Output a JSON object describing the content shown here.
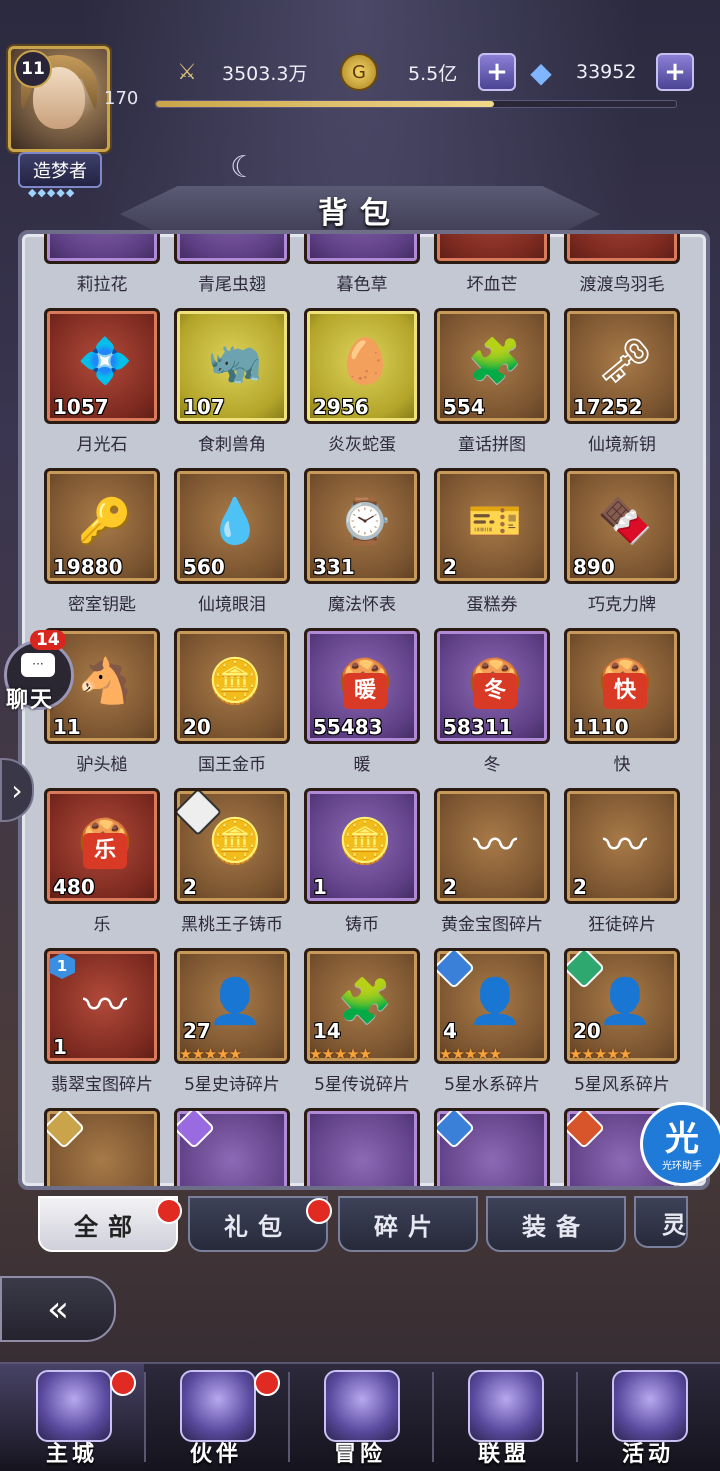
{
  "header": {
    "player_level": "11",
    "rank_title": "造梦者",
    "rank_stars": "◆◆◆◆◆",
    "exp_value": "170",
    "exp_progress": 0.65,
    "power": "3503.3万",
    "gold": "5.5亿",
    "diamonds": "33952",
    "plus": "+"
  },
  "page_title": "背包",
  "colors": {
    "accent": "#8b7fd6",
    "reddot": "#e02a22",
    "panel": "#c4c8d3"
  },
  "items": [
    {
      "name": "莉拉花",
      "qty": "",
      "q": "purple",
      "icon": "🌸"
    },
    {
      "name": "青尾虫翅",
      "qty": "",
      "q": "purple",
      "icon": "🦋"
    },
    {
      "name": "暮色草",
      "qty": "",
      "q": "purple",
      "icon": "🌿"
    },
    {
      "name": "坏血芒",
      "qty": "",
      "q": "red",
      "icon": "🍂"
    },
    {
      "name": "渡渡鸟羽毛",
      "qty": "",
      "q": "red",
      "icon": "🪶"
    },
    {
      "name": "月光石",
      "qty": "1057",
      "q": "red",
      "icon": "💠"
    },
    {
      "name": "食刺兽角",
      "qty": "107",
      "q": "gold",
      "icon": "🦏"
    },
    {
      "name": "炎灰蛇蛋",
      "qty": "2956",
      "q": "gold",
      "icon": "🥚"
    },
    {
      "name": "童话拼图",
      "qty": "554",
      "q": "bronze",
      "icon": "🧩"
    },
    {
      "name": "仙境新钥",
      "qty": "17252",
      "q": "bronze",
      "icon": "🗝"
    },
    {
      "name": "密室钥匙",
      "qty": "19880",
      "q": "bronze",
      "icon": "🔑"
    },
    {
      "name": "仙境眼泪",
      "qty": "560",
      "q": "bronze",
      "icon": "💧"
    },
    {
      "name": "魔法怀表",
      "qty": "331",
      "q": "bronze",
      "icon": "⌚"
    },
    {
      "name": "蛋糕券",
      "qty": "2",
      "q": "bronze",
      "icon": "🎫"
    },
    {
      "name": "巧克力牌",
      "qty": "890",
      "q": "bronze",
      "icon": "🍫"
    },
    {
      "name": "驴头槌",
      "qty": "11",
      "q": "bronze",
      "icon": "🐴"
    },
    {
      "name": "国王金币",
      "qty": "20",
      "q": "bronze",
      "icon": "🪙"
    },
    {
      "name": "暖",
      "qty": "55483",
      "q": "purple",
      "icon": "🍪",
      "glyph": "暖"
    },
    {
      "name": "冬",
      "qty": "58311",
      "q": "purple",
      "icon": "🍪",
      "glyph": "冬"
    },
    {
      "name": "快",
      "qty": "1110",
      "q": "bronze",
      "icon": "🍪",
      "glyph": "快"
    },
    {
      "name": "乐",
      "qty": "480",
      "q": "red",
      "icon": "🍪",
      "glyph": "乐"
    },
    {
      "name": "黑桃王子铸币",
      "qty": "2",
      "q": "bronze",
      "icon": "🪙",
      "badge": "portrait"
    },
    {
      "name": "铸币",
      "qty": "1",
      "q": "purple",
      "icon": "🪙"
    },
    {
      "name": "黄金宝图碎片",
      "qty": "2",
      "q": "bronze",
      "icon": "〰"
    },
    {
      "name": "狂徒碎片",
      "qty": "2",
      "q": "bronze",
      "icon": "〰"
    },
    {
      "name": "翡翠宝图碎片",
      "qty": "1",
      "q": "red",
      "icon": "〰",
      "badge": "hex",
      "badge_text": "1"
    },
    {
      "name": "5星史诗碎片",
      "qty": "27",
      "q": "bronze",
      "icon": "👤",
      "stars": "★★★★★"
    },
    {
      "name": "5星传说碎片",
      "qty": "14",
      "q": "bronze",
      "icon": "🧩",
      "stars": "★★★★★"
    },
    {
      "name": "5星水系碎片",
      "qty": "4",
      "q": "bronze",
      "icon": "👤",
      "stars": "★★★★★",
      "badge": "element",
      "badge_color": "#3a7fd8"
    },
    {
      "name": "5星风系碎片",
      "qty": "20",
      "q": "bronze",
      "icon": "👤",
      "stars": "★★★★★",
      "badge": "element",
      "badge_color": "#2fa870"
    },
    {
      "name": "",
      "qty": "",
      "q": "bronze",
      "icon": "",
      "badge": "element",
      "badge_color": "#c9a44a"
    },
    {
      "name": "",
      "qty": "",
      "q": "purple",
      "icon": "",
      "badge": "element",
      "badge_color": "#9a6ae0"
    },
    {
      "name": "",
      "qty": "",
      "q": "purple",
      "icon": ""
    },
    {
      "name": "",
      "qty": "",
      "q": "purple",
      "icon": "",
      "badge": "element",
      "badge_color": "#3a7fd8"
    },
    {
      "name": "",
      "qty": "",
      "q": "purple",
      "icon": "",
      "badge": "element",
      "badge_color": "#d8542a"
    }
  ],
  "tabs": [
    {
      "label": "全部",
      "active": true,
      "dot": true
    },
    {
      "label": "礼包",
      "active": false,
      "dot": true
    },
    {
      "label": "碎片",
      "active": false,
      "dot": false
    },
    {
      "label": "装备",
      "active": false,
      "dot": false
    },
    {
      "label": "灵",
      "active": false,
      "dot": false
    }
  ],
  "chat": {
    "label": "聊天",
    "count": "14",
    "icon": "···"
  },
  "helper": {
    "big": "光",
    "small": "光环助手"
  },
  "nav": [
    {
      "label": "主城",
      "active": true,
      "dot": true,
      "icon": "castle-icon"
    },
    {
      "label": "伙伴",
      "active": false,
      "dot": true,
      "icon": "hat-icon"
    },
    {
      "label": "冒险",
      "active": false,
      "dot": false,
      "icon": "compass-icon"
    },
    {
      "label": "联盟",
      "active": false,
      "dot": false,
      "icon": "shield-icon"
    },
    {
      "label": "活动",
      "active": false,
      "dot": false,
      "icon": "cards-icon"
    }
  ]
}
